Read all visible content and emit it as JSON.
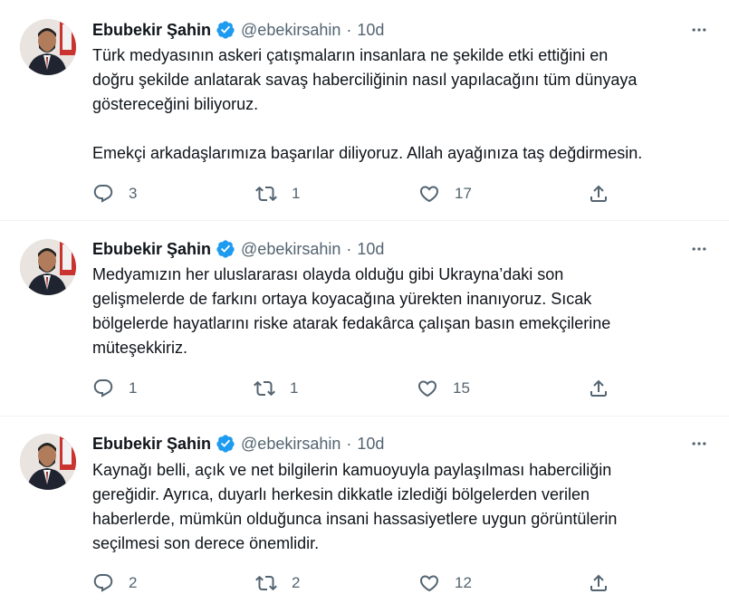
{
  "colors": {
    "accent": "#1d9bf0",
    "text": "#0f1419",
    "muted": "#536471",
    "divider": "#eff3f4"
  },
  "tweets": [
    {
      "author": {
        "name": "Ebubekir Şahin",
        "handle": "@ebekirsahin",
        "separator": "·",
        "time": "10d"
      },
      "lines": [
        "Türk medyasının askeri çatışmaların insanlara ne şekilde etki ettiğini en",
        "doğru şekilde anlatarak savaş haberciliğinin nasıl yapılacağını tüm dünyaya",
        "göstereceğini biliyoruz.",
        "",
        "Emekçi arkadaşlarımıza başarılar diliyoruz. Allah ayağınıza taş değdirmesin."
      ],
      "replies": "3",
      "retweets": "1",
      "likes": "17"
    },
    {
      "author": {
        "name": "Ebubekir Şahin",
        "handle": "@ebekirsahin",
        "separator": "·",
        "time": "10d"
      },
      "lines": [
        "Medyamızın her uluslararası olayda olduğu gibi Ukrayna’daki son",
        "gelişmelerde de farkını ortaya koyacağına yürekten inanıyoruz. Sıcak",
        "bölgelerde hayatlarını riske atarak fedakârca çalışan basın emekçilerine",
        "müteşekkiriz."
      ],
      "replies": "1",
      "retweets": "1",
      "likes": "15"
    },
    {
      "author": {
        "name": "Ebubekir Şahin",
        "handle": "@ebekirsahin",
        "separator": "·",
        "time": "10d"
      },
      "lines": [
        "Kaynağı belli, açık ve net bilgilerin kamuoyuyla paylaşılması haberciliğin",
        "gereğidir. Ayrıca, duyarlı herkesin dikkatle izlediği bölgelerden verilen",
        "haberlerde, mümkün olduğunca insani hassasiyetlere uygun görüntülerin",
        "seçilmesi son derece önemlidir."
      ],
      "replies": "2",
      "retweets": "2",
      "likes": "12"
    }
  ]
}
